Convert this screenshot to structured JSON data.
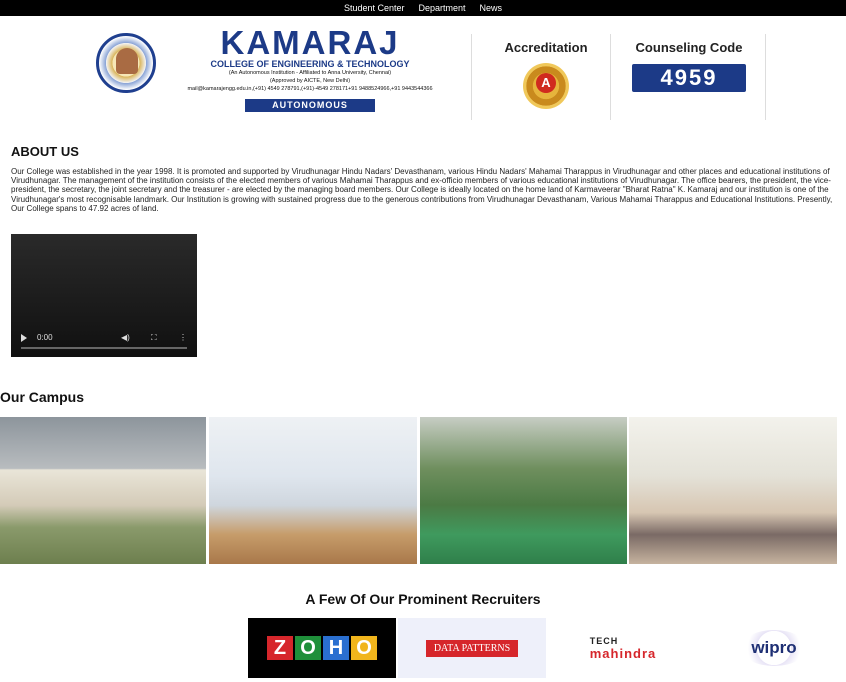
{
  "topnav": [
    "Student Center",
    "Department",
    "News"
  ],
  "header": {
    "name": "KAMARAJ",
    "subtitle": "COLLEGE OF ENGINEERING & TECHNOLOGY",
    "autonomous_line": "(An Autonomous Institution - Affiliated to Anna University, Chennai)",
    "approved": "(Approved by AICTE, New Delhi)",
    "contact": "mail@kamarajengg.edu.in,(+91) 4549 278791,(+91)-4549 278171+91 9488524966,+91 9443544366",
    "autonomous_badge": "AUTONOMOUS",
    "accreditation_label": "Accreditation",
    "accreditation_grade": "A",
    "counseling_label": "Counseling Code",
    "counseling_code": "4959"
  },
  "about": {
    "heading": "ABOUT US",
    "text": "Our College was established in the year 1998. It is promoted and supported by Virudhunagar Hindu Nadars' Devasthanam, various Hindu Nadars' Mahamai Tharappus in Virudhunagar and other places and educational institutions of Virudhunagar. The management of the institution consists of the elected members of various Mahamai Tharappus and ex-officio members of various educational institutions of Virudhunagar. The office bearers, the president, the vice-president, the secretary, the joint secretary and the treasurer - are elected by the managing board members. Our College is ideally located on the home land of Karmaveerar \"Bharat Ratna\" K. Kamaraj and our institution is one of the Virudhunagar's most recognisable landmark. Our Institution is growing with sustained progress due to the generous contributions from Virudhunagar Devasthanam, Various Mahamai Tharappus and Educational Institutions. Presently, Our College spans to 47.92 acres of land."
  },
  "video": {
    "time": "0:00"
  },
  "campus": {
    "heading": "Our Campus"
  },
  "recruiters": {
    "heading": "A Few Of Our Prominent Recruiters",
    "zoho": [
      "Z",
      "O",
      "H",
      "O"
    ],
    "zoho_colors": [
      "#d6262b",
      "#1f8f3a",
      "#2a6fd0",
      "#f1b51c"
    ],
    "data_patterns": "DATA PATTERNS",
    "tech_mahindra_top": "TECH",
    "tech_mahindra_bottom": "mahindra",
    "wipro": "wipro"
  }
}
